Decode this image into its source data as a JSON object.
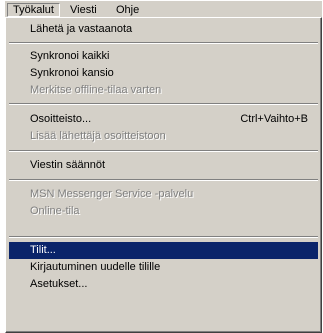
{
  "menubar": {
    "items": [
      {
        "label": "Työkalut"
      },
      {
        "label": "Viesti"
      },
      {
        "label": "Ohje"
      }
    ]
  },
  "menu": {
    "send_receive": {
      "label": "Lähetä ja vastaanota"
    },
    "sync_all": {
      "label": "Synkronoi kaikki"
    },
    "sync_folder": {
      "label": "Synkronoi kansio"
    },
    "mark_offline": {
      "label": "Merkitse offline-tilaa varten"
    },
    "address_book": {
      "label": "Osoitteisto...",
      "shortcut": "Ctrl+Vaihto+B"
    },
    "add_sender": {
      "label": "Lisää lähettäjä osoitteistoon"
    },
    "message_rules": {
      "label": "Viestin säännöt"
    },
    "msn_service": {
      "label": "MSN Messenger Service -palvelu"
    },
    "offline_mode": {
      "label": "Online-tila"
    },
    "accounts": {
      "label": "Tilit..."
    },
    "new_account_signin": {
      "label": "Kirjautuminen uudelle tilille"
    },
    "options": {
      "label": "Asetukset..."
    }
  },
  "colors": {
    "menu_face": "#d4d0c8",
    "highlight": "#0a246a",
    "highlight_text": "#ffffff",
    "disabled_text": "#808080"
  }
}
